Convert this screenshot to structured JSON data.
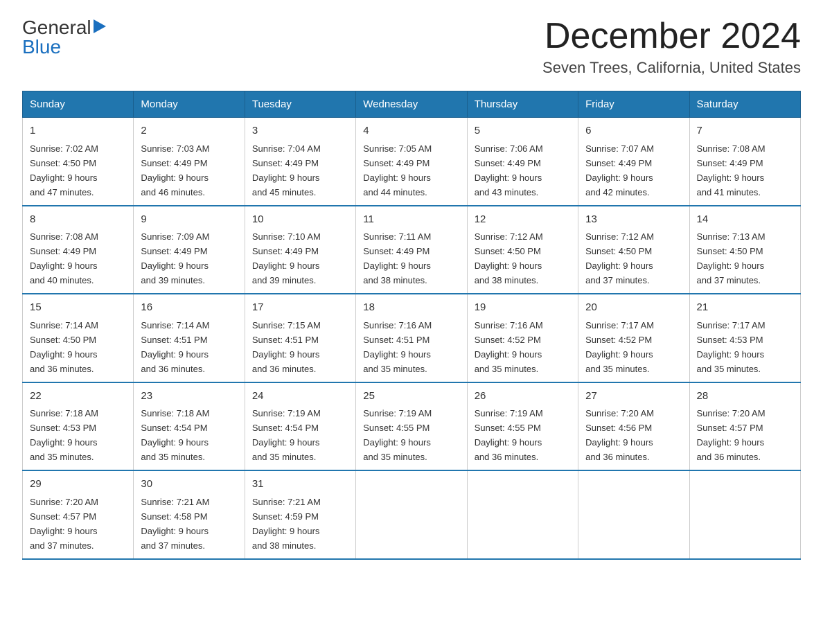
{
  "header": {
    "logo_general": "General",
    "logo_blue": "Blue",
    "title": "December 2024",
    "location": "Seven Trees, California, United States"
  },
  "days_of_week": [
    "Sunday",
    "Monday",
    "Tuesday",
    "Wednesday",
    "Thursday",
    "Friday",
    "Saturday"
  ],
  "weeks": [
    [
      {
        "day": "1",
        "sunrise": "7:02 AM",
        "sunset": "4:50 PM",
        "daylight": "9 hours and 47 minutes."
      },
      {
        "day": "2",
        "sunrise": "7:03 AM",
        "sunset": "4:49 PM",
        "daylight": "9 hours and 46 minutes."
      },
      {
        "day": "3",
        "sunrise": "7:04 AM",
        "sunset": "4:49 PM",
        "daylight": "9 hours and 45 minutes."
      },
      {
        "day": "4",
        "sunrise": "7:05 AM",
        "sunset": "4:49 PM",
        "daylight": "9 hours and 44 minutes."
      },
      {
        "day": "5",
        "sunrise": "7:06 AM",
        "sunset": "4:49 PM",
        "daylight": "9 hours and 43 minutes."
      },
      {
        "day": "6",
        "sunrise": "7:07 AM",
        "sunset": "4:49 PM",
        "daylight": "9 hours and 42 minutes."
      },
      {
        "day": "7",
        "sunrise": "7:08 AM",
        "sunset": "4:49 PM",
        "daylight": "9 hours and 41 minutes."
      }
    ],
    [
      {
        "day": "8",
        "sunrise": "7:08 AM",
        "sunset": "4:49 PM",
        "daylight": "9 hours and 40 minutes."
      },
      {
        "day": "9",
        "sunrise": "7:09 AM",
        "sunset": "4:49 PM",
        "daylight": "9 hours and 39 minutes."
      },
      {
        "day": "10",
        "sunrise": "7:10 AM",
        "sunset": "4:49 PM",
        "daylight": "9 hours and 39 minutes."
      },
      {
        "day": "11",
        "sunrise": "7:11 AM",
        "sunset": "4:49 PM",
        "daylight": "9 hours and 38 minutes."
      },
      {
        "day": "12",
        "sunrise": "7:12 AM",
        "sunset": "4:50 PM",
        "daylight": "9 hours and 38 minutes."
      },
      {
        "day": "13",
        "sunrise": "7:12 AM",
        "sunset": "4:50 PM",
        "daylight": "9 hours and 37 minutes."
      },
      {
        "day": "14",
        "sunrise": "7:13 AM",
        "sunset": "4:50 PM",
        "daylight": "9 hours and 37 minutes."
      }
    ],
    [
      {
        "day": "15",
        "sunrise": "7:14 AM",
        "sunset": "4:50 PM",
        "daylight": "9 hours and 36 minutes."
      },
      {
        "day": "16",
        "sunrise": "7:14 AM",
        "sunset": "4:51 PM",
        "daylight": "9 hours and 36 minutes."
      },
      {
        "day": "17",
        "sunrise": "7:15 AM",
        "sunset": "4:51 PM",
        "daylight": "9 hours and 36 minutes."
      },
      {
        "day": "18",
        "sunrise": "7:16 AM",
        "sunset": "4:51 PM",
        "daylight": "9 hours and 35 minutes."
      },
      {
        "day": "19",
        "sunrise": "7:16 AM",
        "sunset": "4:52 PM",
        "daylight": "9 hours and 35 minutes."
      },
      {
        "day": "20",
        "sunrise": "7:17 AM",
        "sunset": "4:52 PM",
        "daylight": "9 hours and 35 minutes."
      },
      {
        "day": "21",
        "sunrise": "7:17 AM",
        "sunset": "4:53 PM",
        "daylight": "9 hours and 35 minutes."
      }
    ],
    [
      {
        "day": "22",
        "sunrise": "7:18 AM",
        "sunset": "4:53 PM",
        "daylight": "9 hours and 35 minutes."
      },
      {
        "day": "23",
        "sunrise": "7:18 AM",
        "sunset": "4:54 PM",
        "daylight": "9 hours and 35 minutes."
      },
      {
        "day": "24",
        "sunrise": "7:19 AM",
        "sunset": "4:54 PM",
        "daylight": "9 hours and 35 minutes."
      },
      {
        "day": "25",
        "sunrise": "7:19 AM",
        "sunset": "4:55 PM",
        "daylight": "9 hours and 35 minutes."
      },
      {
        "day": "26",
        "sunrise": "7:19 AM",
        "sunset": "4:55 PM",
        "daylight": "9 hours and 36 minutes."
      },
      {
        "day": "27",
        "sunrise": "7:20 AM",
        "sunset": "4:56 PM",
        "daylight": "9 hours and 36 minutes."
      },
      {
        "day": "28",
        "sunrise": "7:20 AM",
        "sunset": "4:57 PM",
        "daylight": "9 hours and 36 minutes."
      }
    ],
    [
      {
        "day": "29",
        "sunrise": "7:20 AM",
        "sunset": "4:57 PM",
        "daylight": "9 hours and 37 minutes."
      },
      {
        "day": "30",
        "sunrise": "7:21 AM",
        "sunset": "4:58 PM",
        "daylight": "9 hours and 37 minutes."
      },
      {
        "day": "31",
        "sunrise": "7:21 AM",
        "sunset": "4:59 PM",
        "daylight": "9 hours and 38 minutes."
      },
      null,
      null,
      null,
      null
    ]
  ],
  "labels": {
    "sunrise": "Sunrise: ",
    "sunset": "Sunset: ",
    "daylight": "Daylight: "
  }
}
